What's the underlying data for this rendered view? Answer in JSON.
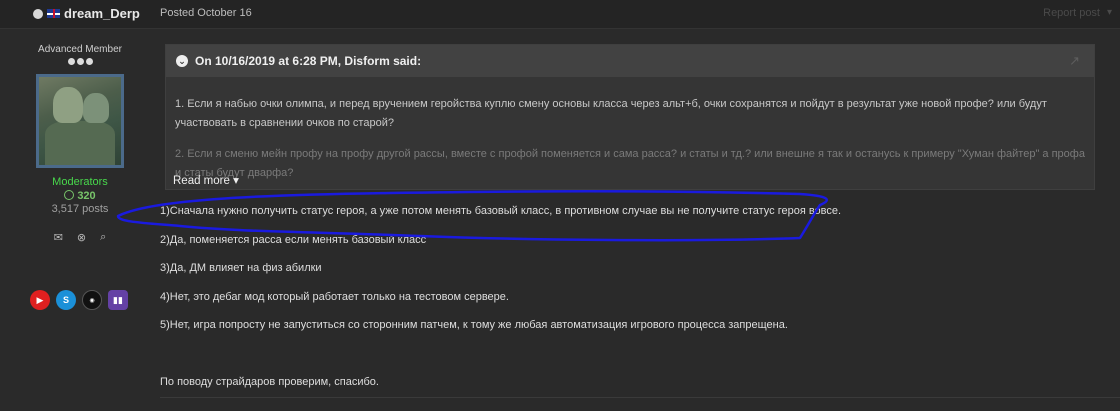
{
  "post": {
    "author": "dream_Derp",
    "posted": "Posted October 16",
    "report": "Report post"
  },
  "sidebar": {
    "rank": "Advanced Member",
    "group": "Moderators",
    "reputation": "320",
    "posts": "3,517 posts",
    "icons": [
      "envelope-icon",
      "block-icon",
      "search-icon"
    ],
    "socials": {
      "youtube": "▶",
      "skype": "S",
      "custom": "◉",
      "twitch": "▮▮"
    }
  },
  "quote": {
    "title": "On 10/16/2019 at 6:28 PM, Disform said:",
    "p1": "1. Если я набью очки олимпа, и перед вручением геройства куплю смену основы класса через альт+б, очки сохранятся и пойдут в результат уже новой профе? или будут участвовать в сравнении очков по старой?",
    "p2": "2. Если я сменю мейн профу на профу другой рассы, вместе с профой поменяется и сама расса? и статы и тд.? или внешне я так и останусь к примеру \"Хуман файтер\" а профа и статы будут дварфа?",
    "read_more": "Read more"
  },
  "reply": {
    "l1": "1)Сначала нужно получить статус героя, а уже потом менять базовый класс, в противном случае вы не получите статус героя вовсе.",
    "l2": "2)Да, поменяется расса если менять базовый класс",
    "l3": "3)Да, ДМ влияет на физ абилки",
    "l4": "4)Нет, это дебаг мод который работает только на тестовом сервере.",
    "l5": "5)Нет, игра попросту не запуститься со сторонним патчем, к тому же любая автоматизация игрового процесса запрещена.",
    "l6": "По поводу страйдаров проверим, спасибо."
  },
  "colors": {
    "background": "#2a2a2a",
    "moderator_green": "#48d84c",
    "annotation_blue": "#1a1adf"
  }
}
